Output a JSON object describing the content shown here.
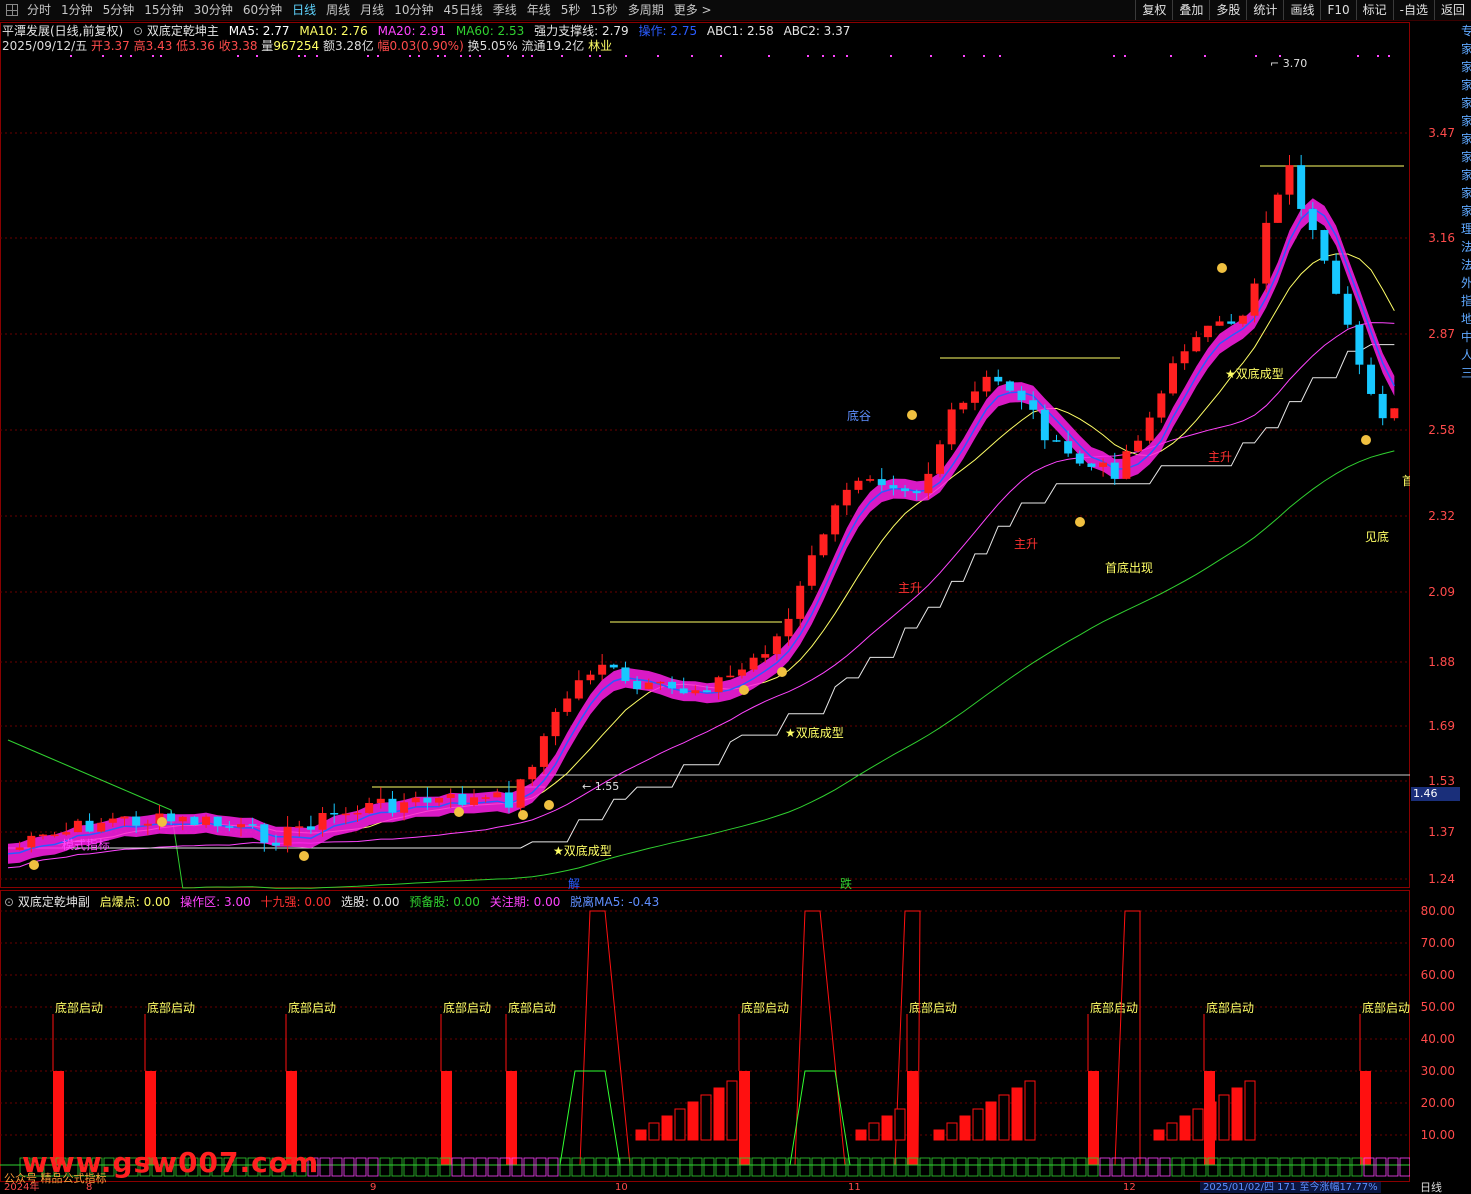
{
  "toolbar": {
    "periods": [
      "分时",
      "1分钟",
      "5分钟",
      "15分钟",
      "30分钟",
      "60分钟",
      "日线",
      "周线",
      "月线",
      "10分钟",
      "45日线",
      "季线",
      "年线",
      "5秒",
      "15秒",
      "多周期",
      "更多 >"
    ],
    "active_period": "日线",
    "right_buttons": [
      "复权",
      "叠加",
      "多股",
      "统计",
      "画线",
      "F10",
      "标记",
      "-自选",
      "返回"
    ]
  },
  "header": {
    "stock": "平潭发展(日线,前复权)",
    "indicator": "双底定乾坤主",
    "ma5": "MA5: 2.77",
    "ma10": "MA10: 2.76",
    "ma20": "MA20: 2.91",
    "ma60": "MA60: 2.53",
    "support": "强力支撑线: 2.79",
    "operate": "操作: 2.75",
    "abc1": "ABC1: 2.58",
    "abc2": "ABC2: 3.37"
  },
  "quote": {
    "date": "2025/09/12/五",
    "open_label": "开",
    "open": "3.37",
    "high_label": "高",
    "high": "3.43",
    "low_label": "低",
    "low": "3.36",
    "close_label": "收",
    "close": "3.38",
    "vol_label": "量",
    "vol": "967254",
    "amt_label": "额",
    "amt": "3.28亿",
    "chg_label": "幅",
    "chg": "0.03(0.90%)",
    "turn_label": "换",
    "turn": "5.05%",
    "float_label": "流通",
    "float": "19.2亿",
    "industry": "林业"
  },
  "price_axis": [
    "3.47",
    "3.16",
    "2.87",
    "2.58",
    "2.32",
    "2.09",
    "1.88",
    "1.69",
    "1.53",
    "1.37",
    "1.24"
  ],
  "current_price_tag": "1.46",
  "chart_annotations": {
    "high_marker": "3.70",
    "low_marker": "1.55",
    "double_bottom_1": "★双底成型",
    "double_bottom_2": "★双底成型",
    "double_bottom_3": "★双底成型",
    "main_rise_1": "主升",
    "main_rise_2": "主升",
    "main_rise_3": "主升",
    "first_bottom": "首底出现",
    "see_bottom": "见底",
    "shou": "首",
    "valley": "底谷",
    "jie": "解",
    "die": "跌",
    "left_label": "模式指标"
  },
  "sub_header": {
    "name": "双底定乾坤副",
    "qbd": "启爆点: 0.00",
    "czq": "操作区: 3.00",
    "sjq": "十九强: 0.00",
    "xg": "选股: 0.00",
    "ybg": "预备股: 0.00",
    "gzq": "关注期: 0.00",
    "tl": "脱离MA5: -0.43"
  },
  "sub_axis": [
    "80.00",
    "70.00",
    "60.00",
    "50.00",
    "40.00",
    "30.00",
    "20.00",
    "10.00"
  ],
  "sub_label": "底部启动",
  "right_strip": [
    "专",
    "家",
    "家",
    "家",
    "家",
    "家",
    "家",
    "家",
    "家",
    "家",
    "家",
    "理",
    "法",
    "法",
    "外",
    "指",
    "地",
    "中",
    "人",
    "三"
  ],
  "date_axis": [
    "2024年",
    "8",
    "9",
    "10",
    "11",
    "12"
  ],
  "status": "2025/01/02/四 171 至今涨幅17.77%",
  "bottom_right": "日线",
  "watermark": "www.gsw007.com",
  "watermark_sub": "公众号 精品公式指标",
  "colors": {
    "up": "#ff2020",
    "down": "#18c8ff",
    "band": "#ff1ee8",
    "cloud": "#1e78b4",
    "ma_yellow": "#ffff66",
    "ma_magenta": "#ff44ff",
    "ma_green": "#30d030",
    "support_white": "#e8e8e8"
  }
}
